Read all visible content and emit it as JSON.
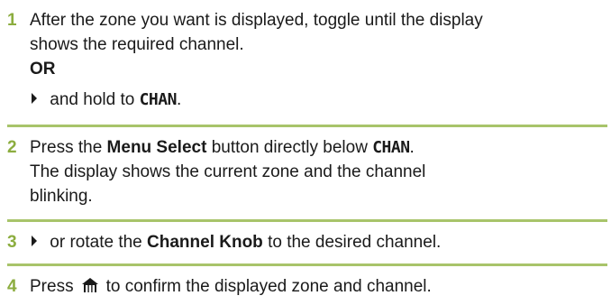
{
  "steps": [
    {
      "number": "1",
      "line1": "After the zone you want is displayed, toggle until the display",
      "line2": "shows the required channel.",
      "or_label": "OR",
      "alt_text": " and hold to ",
      "chan_label": "CHAN",
      "alt_end": "."
    },
    {
      "number": "2",
      "pre": "Press the ",
      "button_label": "Menu Select",
      "mid": " button directly below ",
      "chan_label": "CHAN",
      "end": ".",
      "line2": "The display shows the current zone and the channel",
      "line3": "blinking."
    },
    {
      "number": "3",
      "pre": " or rotate the ",
      "knob_label": "Channel Knob",
      "end": " to the desired channel."
    },
    {
      "number": "4",
      "pre": "Press",
      "end": "to confirm the displayed zone and channel."
    }
  ],
  "colors": {
    "accent": "#8cad3f",
    "rule": "#a8c46a",
    "text": "#1a1a1a"
  },
  "icons": [
    "right-arrow-icon",
    "home-icon"
  ]
}
